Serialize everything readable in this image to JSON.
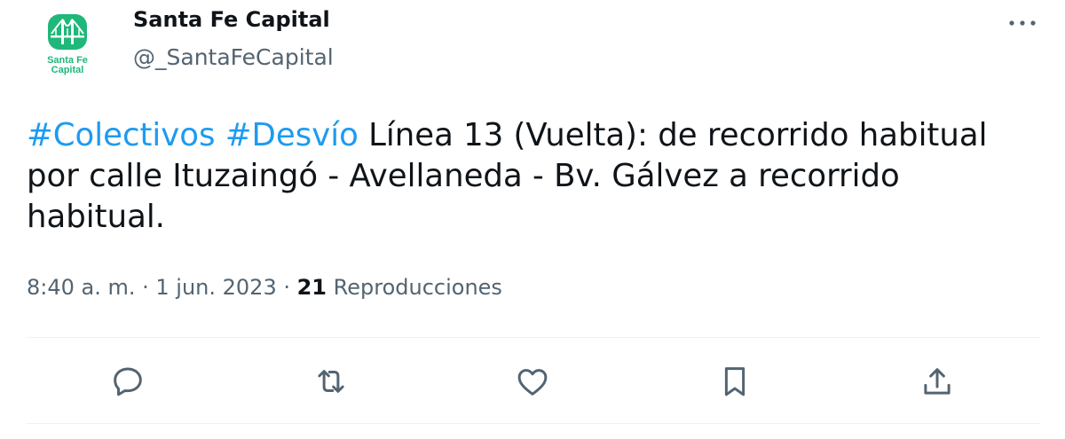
{
  "author": {
    "name": "Santa Fe Capital",
    "handle": "@_SantaFeCapital",
    "avatar_icon": "santa-fe-capital-logo",
    "avatar_text_line1": "Santa Fe",
    "avatar_text_line2": "Capital",
    "brand_color": "#1fb77a"
  },
  "tweet": {
    "hashtag1": "#Colectivos",
    "hashtag2": "#Desvío",
    "body": " Línea 13 (Vuelta): de recorrido habitual por calle Ituzaingó - Avellaneda - Bv. Gálvez a recorrido habitual.",
    "hashtag_color": "#1d9bf0"
  },
  "meta": {
    "time": "8:40 a. m.",
    "sep1": " · ",
    "date": "1 jun. 2023",
    "sep2": " · ",
    "views_count": "21",
    "views_label": " Reproducciones"
  },
  "actions": [
    {
      "icon": "reply-icon"
    },
    {
      "icon": "retweet-icon"
    },
    {
      "icon": "like-icon"
    },
    {
      "icon": "bookmark-icon"
    },
    {
      "icon": "share-icon"
    }
  ],
  "more_icon": "more-options-icon"
}
